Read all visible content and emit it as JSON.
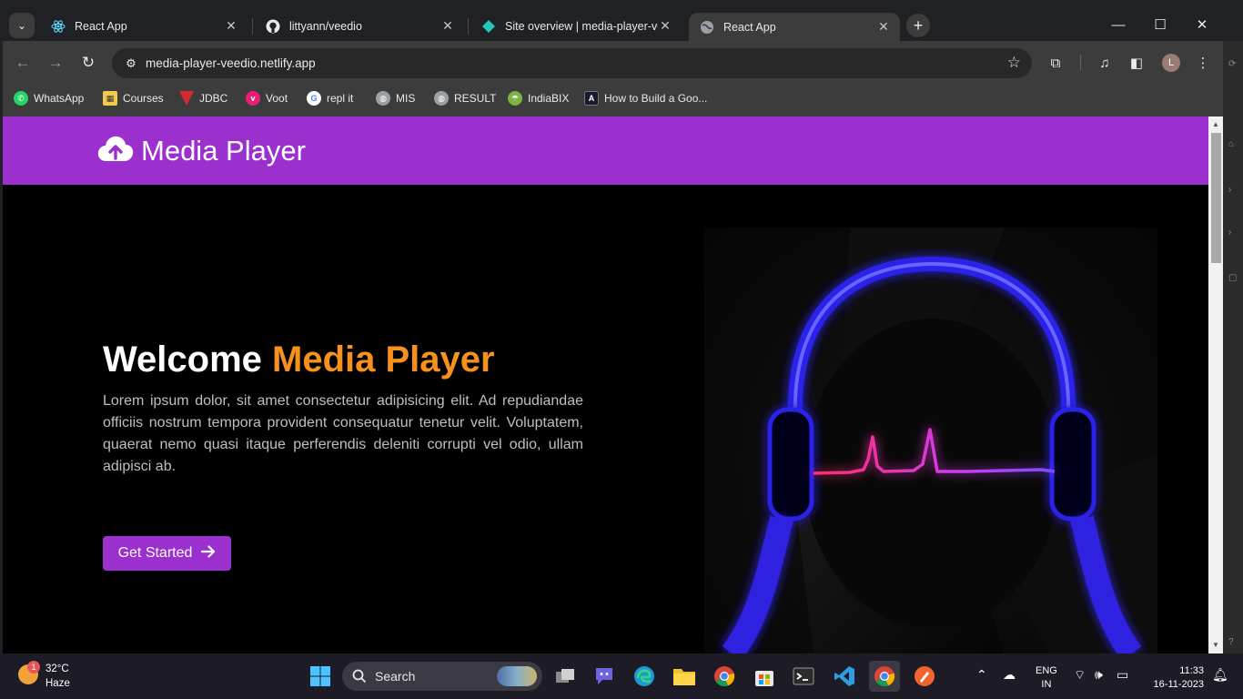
{
  "browser": {
    "tabs": [
      {
        "title": "React App",
        "icon": "react-icon"
      },
      {
        "title": "littyann/veedio",
        "icon": "github-icon"
      },
      {
        "title": "Site overview | media-player-ve",
        "icon": "netlify-icon"
      },
      {
        "title": "React App",
        "icon": "globe-icon",
        "active": true
      }
    ],
    "url": "media-player-veedio.netlify.app",
    "profile_initial": "L",
    "bookmarks": [
      {
        "label": "WhatsApp",
        "icon": "whatsapp-icon",
        "color": "#25d366"
      },
      {
        "label": "Courses",
        "icon": "courses-icon",
        "color": "#f2c94c"
      },
      {
        "label": "JDBC",
        "icon": "jdbc-icon",
        "color": "#d5282f"
      },
      {
        "label": "Voot",
        "icon": "voot-icon",
        "color": "#e91e78"
      },
      {
        "label": "repl it",
        "icon": "google-icon",
        "color": "#ffffff"
      },
      {
        "label": "MIS",
        "icon": "globe-icon",
        "color": "#9aa0a6"
      },
      {
        "label": "RESULT",
        "icon": "globe-icon",
        "color": "#9aa0a6"
      },
      {
        "label": "IndiaBIX",
        "icon": "indiabix-icon",
        "color": "#7cb342"
      },
      {
        "label": "How to Build a Goo...",
        "icon": "build-icon",
        "color": "#1a1a2e"
      }
    ]
  },
  "site": {
    "brand": "Media Player",
    "hero": {
      "title_plain": "Welcome",
      "title_accent": "Media Player",
      "body": "Lorem ipsum dolor, sit amet consectetur adipisicing elit. Ad repudiandae officiis nostrum tempora provident consequatur tenetur velit. Voluptatem, quaerat nemo quasi itaque perferendis deleniti corrupti vel odio, ullam adipisci ab.",
      "cta": "Get Started"
    },
    "colors": {
      "header": "#9b30cf",
      "accent": "#f7911d",
      "button": "#9b30cf"
    }
  },
  "taskbar": {
    "weather": {
      "temp": "32°C",
      "desc": "Haze",
      "badge": "1"
    },
    "search": "Search",
    "language": [
      "ENG",
      "IN"
    ],
    "time": "11:33",
    "date": "16-11-2023"
  }
}
